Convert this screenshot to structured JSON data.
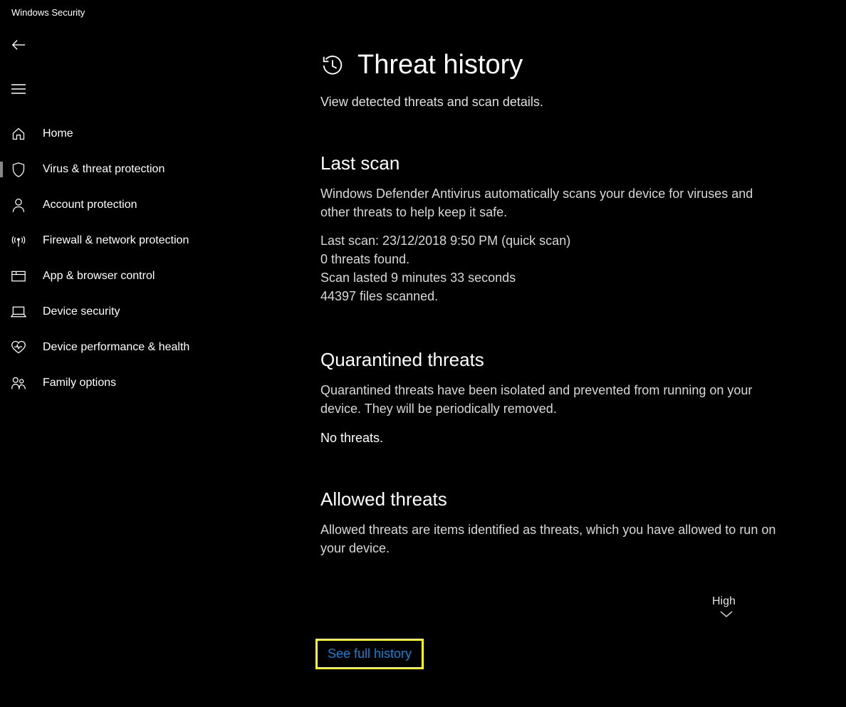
{
  "app": {
    "title": "Windows Security"
  },
  "nav": {
    "items": [
      {
        "label": "Home"
      },
      {
        "label": "Virus & threat protection"
      },
      {
        "label": "Account protection"
      },
      {
        "label": "Firewall & network protection"
      },
      {
        "label": "App & browser control"
      },
      {
        "label": "Device security"
      },
      {
        "label": "Device performance & health"
      },
      {
        "label": "Family options"
      }
    ]
  },
  "page": {
    "title": "Threat history",
    "subtitle": "View detected threats and scan details."
  },
  "last_scan": {
    "title": "Last scan",
    "desc": "Windows Defender Antivirus automatically scans your device for viruses and other threats to help keep it safe.",
    "line1": "Last scan: 23/12/2018 9:50 PM (quick scan)",
    "line2": "0 threats found.",
    "line3": "Scan lasted 9 minutes 33 seconds",
    "line4": "44397 files scanned."
  },
  "quarantined": {
    "title": "Quarantined threats",
    "desc": "Quarantined threats have been isolated and prevented from running on your device. They will be periodically removed.",
    "status": "No threats."
  },
  "allowed": {
    "title": "Allowed threats",
    "desc": "Allowed threats are items identified as threats, which you have allowed to run on your device."
  },
  "sort": {
    "label": "High"
  },
  "link": {
    "see_full_history": "See full history"
  }
}
